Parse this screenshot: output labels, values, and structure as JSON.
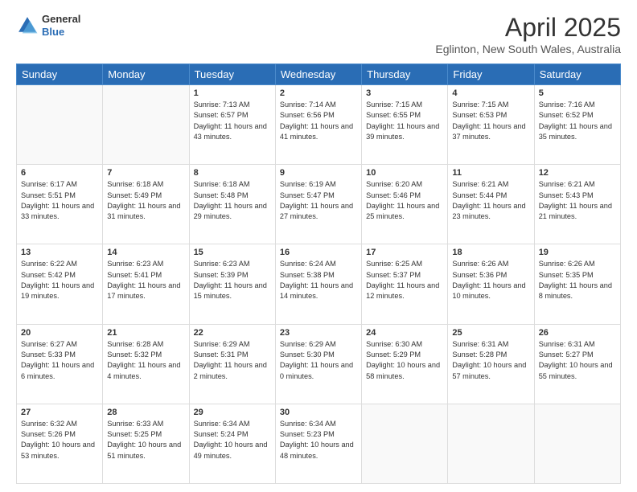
{
  "header": {
    "logo": {
      "line1": "General",
      "line2": "Blue"
    },
    "title": "April 2025",
    "location": "Eglinton, New South Wales, Australia"
  },
  "days_of_week": [
    "Sunday",
    "Monday",
    "Tuesday",
    "Wednesday",
    "Thursday",
    "Friday",
    "Saturday"
  ],
  "weeks": [
    [
      {
        "day": "",
        "sunrise": "",
        "sunset": "",
        "daylight": "",
        "empty": true
      },
      {
        "day": "",
        "sunrise": "",
        "sunset": "",
        "daylight": "",
        "empty": true
      },
      {
        "day": "1",
        "sunrise": "Sunrise: 7:13 AM",
        "sunset": "Sunset: 6:57 PM",
        "daylight": "Daylight: 11 hours and 43 minutes."
      },
      {
        "day": "2",
        "sunrise": "Sunrise: 7:14 AM",
        "sunset": "Sunset: 6:56 PM",
        "daylight": "Daylight: 11 hours and 41 minutes."
      },
      {
        "day": "3",
        "sunrise": "Sunrise: 7:15 AM",
        "sunset": "Sunset: 6:55 PM",
        "daylight": "Daylight: 11 hours and 39 minutes."
      },
      {
        "day": "4",
        "sunrise": "Sunrise: 7:15 AM",
        "sunset": "Sunset: 6:53 PM",
        "daylight": "Daylight: 11 hours and 37 minutes."
      },
      {
        "day": "5",
        "sunrise": "Sunrise: 7:16 AM",
        "sunset": "Sunset: 6:52 PM",
        "daylight": "Daylight: 11 hours and 35 minutes."
      }
    ],
    [
      {
        "day": "6",
        "sunrise": "Sunrise: 6:17 AM",
        "sunset": "Sunset: 5:51 PM",
        "daylight": "Daylight: 11 hours and 33 minutes."
      },
      {
        "day": "7",
        "sunrise": "Sunrise: 6:18 AM",
        "sunset": "Sunset: 5:49 PM",
        "daylight": "Daylight: 11 hours and 31 minutes."
      },
      {
        "day": "8",
        "sunrise": "Sunrise: 6:18 AM",
        "sunset": "Sunset: 5:48 PM",
        "daylight": "Daylight: 11 hours and 29 minutes."
      },
      {
        "day": "9",
        "sunrise": "Sunrise: 6:19 AM",
        "sunset": "Sunset: 5:47 PM",
        "daylight": "Daylight: 11 hours and 27 minutes."
      },
      {
        "day": "10",
        "sunrise": "Sunrise: 6:20 AM",
        "sunset": "Sunset: 5:46 PM",
        "daylight": "Daylight: 11 hours and 25 minutes."
      },
      {
        "day": "11",
        "sunrise": "Sunrise: 6:21 AM",
        "sunset": "Sunset: 5:44 PM",
        "daylight": "Daylight: 11 hours and 23 minutes."
      },
      {
        "day": "12",
        "sunrise": "Sunrise: 6:21 AM",
        "sunset": "Sunset: 5:43 PM",
        "daylight": "Daylight: 11 hours and 21 minutes."
      }
    ],
    [
      {
        "day": "13",
        "sunrise": "Sunrise: 6:22 AM",
        "sunset": "Sunset: 5:42 PM",
        "daylight": "Daylight: 11 hours and 19 minutes."
      },
      {
        "day": "14",
        "sunrise": "Sunrise: 6:23 AM",
        "sunset": "Sunset: 5:41 PM",
        "daylight": "Daylight: 11 hours and 17 minutes."
      },
      {
        "day": "15",
        "sunrise": "Sunrise: 6:23 AM",
        "sunset": "Sunset: 5:39 PM",
        "daylight": "Daylight: 11 hours and 15 minutes."
      },
      {
        "day": "16",
        "sunrise": "Sunrise: 6:24 AM",
        "sunset": "Sunset: 5:38 PM",
        "daylight": "Daylight: 11 hours and 14 minutes."
      },
      {
        "day": "17",
        "sunrise": "Sunrise: 6:25 AM",
        "sunset": "Sunset: 5:37 PM",
        "daylight": "Daylight: 11 hours and 12 minutes."
      },
      {
        "day": "18",
        "sunrise": "Sunrise: 6:26 AM",
        "sunset": "Sunset: 5:36 PM",
        "daylight": "Daylight: 11 hours and 10 minutes."
      },
      {
        "day": "19",
        "sunrise": "Sunrise: 6:26 AM",
        "sunset": "Sunset: 5:35 PM",
        "daylight": "Daylight: 11 hours and 8 minutes."
      }
    ],
    [
      {
        "day": "20",
        "sunrise": "Sunrise: 6:27 AM",
        "sunset": "Sunset: 5:33 PM",
        "daylight": "Daylight: 11 hours and 6 minutes."
      },
      {
        "day": "21",
        "sunrise": "Sunrise: 6:28 AM",
        "sunset": "Sunset: 5:32 PM",
        "daylight": "Daylight: 11 hours and 4 minutes."
      },
      {
        "day": "22",
        "sunrise": "Sunrise: 6:29 AM",
        "sunset": "Sunset: 5:31 PM",
        "daylight": "Daylight: 11 hours and 2 minutes."
      },
      {
        "day": "23",
        "sunrise": "Sunrise: 6:29 AM",
        "sunset": "Sunset: 5:30 PM",
        "daylight": "Daylight: 11 hours and 0 minutes."
      },
      {
        "day": "24",
        "sunrise": "Sunrise: 6:30 AM",
        "sunset": "Sunset: 5:29 PM",
        "daylight": "Daylight: 10 hours and 58 minutes."
      },
      {
        "day": "25",
        "sunrise": "Sunrise: 6:31 AM",
        "sunset": "Sunset: 5:28 PM",
        "daylight": "Daylight: 10 hours and 57 minutes."
      },
      {
        "day": "26",
        "sunrise": "Sunrise: 6:31 AM",
        "sunset": "Sunset: 5:27 PM",
        "daylight": "Daylight: 10 hours and 55 minutes."
      }
    ],
    [
      {
        "day": "27",
        "sunrise": "Sunrise: 6:32 AM",
        "sunset": "Sunset: 5:26 PM",
        "daylight": "Daylight: 10 hours and 53 minutes."
      },
      {
        "day": "28",
        "sunrise": "Sunrise: 6:33 AM",
        "sunset": "Sunset: 5:25 PM",
        "daylight": "Daylight: 10 hours and 51 minutes."
      },
      {
        "day": "29",
        "sunrise": "Sunrise: 6:34 AM",
        "sunset": "Sunset: 5:24 PM",
        "daylight": "Daylight: 10 hours and 49 minutes."
      },
      {
        "day": "30",
        "sunrise": "Sunrise: 6:34 AM",
        "sunset": "Sunset: 5:23 PM",
        "daylight": "Daylight: 10 hours and 48 minutes."
      },
      {
        "day": "",
        "sunrise": "",
        "sunset": "",
        "daylight": "",
        "empty": true
      },
      {
        "day": "",
        "sunrise": "",
        "sunset": "",
        "daylight": "",
        "empty": true
      },
      {
        "day": "",
        "sunrise": "",
        "sunset": "",
        "daylight": "",
        "empty": true
      }
    ]
  ]
}
